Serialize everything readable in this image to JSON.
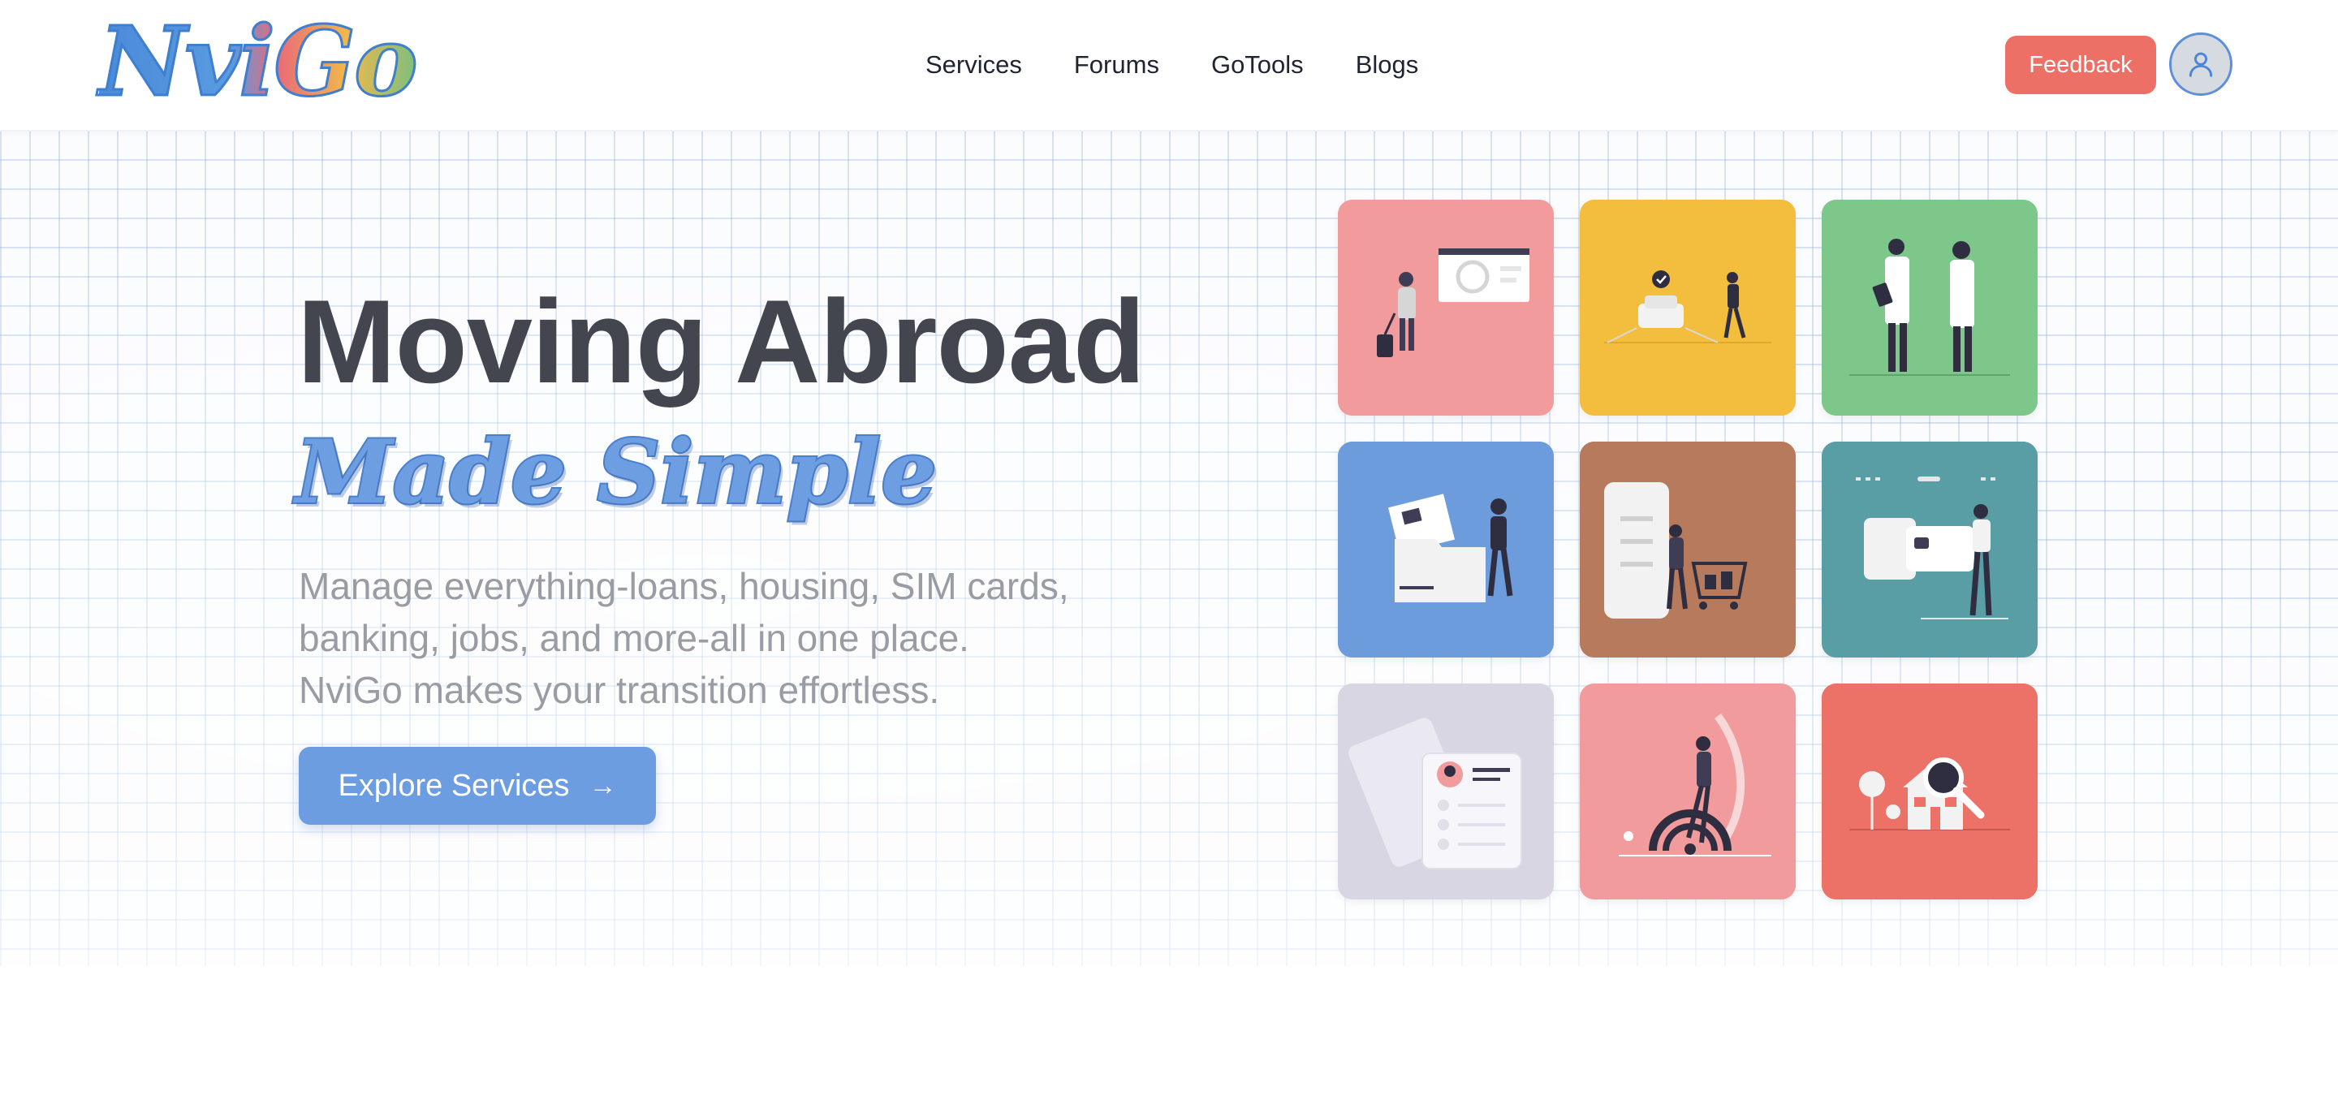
{
  "header": {
    "logo_text": "NviGo",
    "nav": [
      "Services",
      "Forums",
      "GoTools",
      "Blogs"
    ],
    "feedback_label": "Feedback",
    "avatar_icon": "user-icon"
  },
  "hero": {
    "title": "Moving Abroad",
    "subtitle": "Made Simple",
    "description": [
      "Manage everything-loans, housing, SIM cards,",
      "banking, jobs, and more-all in one place.",
      "NviGo makes your transition effortless."
    ],
    "cta_label": "Explore Services",
    "cta_icon": "arrow-right-icon"
  },
  "tiles": [
    {
      "name": "travel-tile",
      "color": "#f29b9c"
    },
    {
      "name": "transport-tile",
      "color": "#f3bd3d"
    },
    {
      "name": "healthcare-tile",
      "color": "#7ec78a"
    },
    {
      "name": "documents-tile",
      "color": "#6c9cdc"
    },
    {
      "name": "shopping-tile",
      "color": "#b87a5d"
    },
    {
      "name": "banking-tile",
      "color": "#5a9ea5"
    },
    {
      "name": "profile-tile",
      "color": "#d9d6e4"
    },
    {
      "name": "sim-connectivity-tile",
      "color": "#f29b9c"
    },
    {
      "name": "housing-tile",
      "color": "#ec7166"
    }
  ]
}
